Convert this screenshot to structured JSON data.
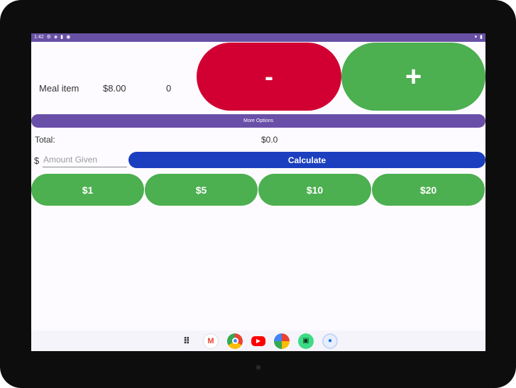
{
  "status_bar": {
    "time": "1:42",
    "left_icons": [
      "gear-icon",
      "shield-icon",
      "sim-icon",
      "android-icon"
    ],
    "right_icons": [
      "wifi-icon",
      "battery-icon"
    ]
  },
  "meal": {
    "label": "Meal item",
    "price": "$8.00",
    "quantity": "0",
    "minus_label": "-",
    "plus_label": "+"
  },
  "more_options_label": "More Options",
  "total": {
    "label": "Total:",
    "value": "$0.0"
  },
  "payment": {
    "currency_symbol": "$",
    "amount_placeholder": "Amount Given",
    "amount_value": "",
    "calculate_label": "Calculate"
  },
  "quick_amounts": [
    "$1",
    "$5",
    "$10",
    "$20"
  ],
  "dock": {
    "apps": [
      "apps-grid-icon",
      "gmail-icon",
      "chrome-icon",
      "youtube-icon",
      "photos-icon",
      "android-icon",
      "messages-icon"
    ]
  },
  "colors": {
    "status_bar": "#6750a4",
    "minus_button": "#d20032",
    "plus_button": "#4caf50",
    "more_options": "#6a4fa8",
    "calculate_button": "#1b3fbf",
    "quick_button": "#4caf50"
  }
}
